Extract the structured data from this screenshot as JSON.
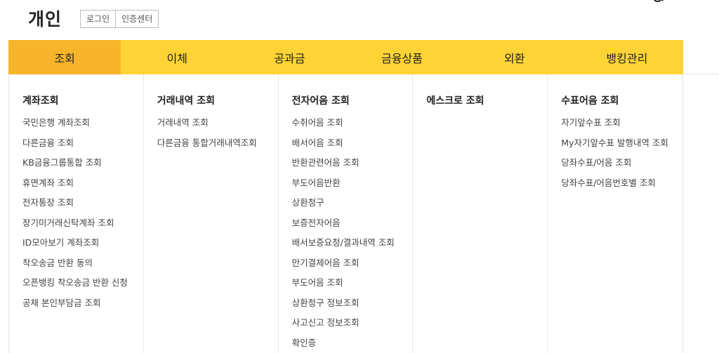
{
  "header": {
    "brand": "개인",
    "login_label": "로그인",
    "cert_label": "인증센터",
    "icons": [
      "search-icon",
      "menu-icon"
    ]
  },
  "nav": {
    "active_index": 0,
    "tabs": [
      {
        "label": "조회"
      },
      {
        "label": "이체"
      },
      {
        "label": "공과금"
      },
      {
        "label": "금융상품"
      },
      {
        "label": "외환"
      },
      {
        "label": "뱅킹관리"
      }
    ]
  },
  "colors": {
    "nav_bg": "#fdd335",
    "nav_active_bg": "#f8b52b"
  },
  "submenu": [
    {
      "title": "계좌조회",
      "items": [
        "국민은행 계좌조회",
        "다른금융 조회",
        "KB금융그룹통합 조회",
        "휴면계좌 조회",
        "전자통장 조회",
        "장기미거래신탁계좌 조회",
        "ID모아보기 계좌조회",
        "착오송금 반환 동의",
        "오픈뱅킹 착오송금 반환 신청",
        "공채 본인부담금 조회"
      ]
    },
    {
      "title": "거래내역 조회",
      "items": [
        "거래내역 조회",
        "다른금융 통합거래내역조회"
      ]
    },
    {
      "title": "전자어음 조회",
      "items": [
        "수취어음 조회",
        "배서어음 조회",
        "반환관련어음 조회",
        "부도어음반환",
        "상환청구",
        "보증전자어음",
        "배서보증요청/결과내역 조회",
        "만기결제어음 조회",
        "부도어음 조회",
        "상환청구 정보조회",
        "사고신고 정보조회",
        "확인증"
      ]
    },
    {
      "title": "에스크로 조회",
      "items": []
    },
    {
      "title": "수표어음 조회",
      "items": [
        "자기앞수표 조회",
        "My자기앞수표 발행내역 조회",
        "당좌수표/어음 조회",
        "당좌수표/어음번호별 조회"
      ]
    }
  ]
}
